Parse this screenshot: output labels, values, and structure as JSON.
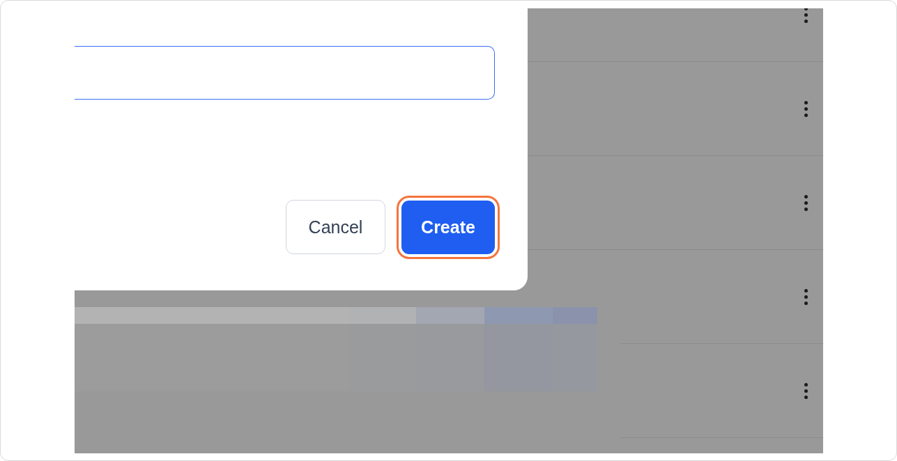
{
  "dialog": {
    "input": {
      "focused": true
    },
    "buttons": [
      {
        "label": "Cancel",
        "kind": "secondary",
        "highlighted": false
      },
      {
        "label": "Create",
        "kind": "primary",
        "highlighted": true
      }
    ]
  },
  "list": {
    "rows": [
      {
        "inset_divider": false
      },
      {
        "inset_divider": false
      },
      {
        "inset_divider": false
      },
      {
        "inset_divider": true,
        "kind": "blurred"
      },
      {
        "inset_divider": true
      }
    ]
  }
}
